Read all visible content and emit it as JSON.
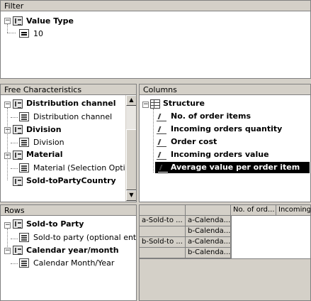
{
  "filter": {
    "title": "Filter",
    "items": [
      {
        "label": "Value Type",
        "value": "10"
      }
    ]
  },
  "free_characteristics": {
    "title": "Free Characteristics",
    "items": [
      {
        "label": "Distribution channel",
        "sub": "Distribution channel"
      },
      {
        "label": "Division",
        "sub": "Division"
      },
      {
        "label": "Material",
        "sub": "Material (Selection Options"
      },
      {
        "label": "Sold-toPartyCountry"
      }
    ]
  },
  "columns": {
    "title": "Columns",
    "root": "Structure",
    "items": [
      {
        "label": "No. of order items"
      },
      {
        "label": "Incoming orders quantity"
      },
      {
        "label": "Order cost"
      },
      {
        "label": "Incoming orders value"
      },
      {
        "label": "Average value per order item",
        "selected": true
      }
    ]
  },
  "rows": {
    "title": "Rows",
    "items": [
      {
        "label": "Sold-to Party",
        "sub": "Sold-to party (optional entry)"
      },
      {
        "label": "Calendar year/month",
        "sub": "Calendar Month/Year"
      }
    ]
  },
  "grid": {
    "headers": [
      "No. of ord...",
      "Incoming"
    ],
    "row_a": [
      "a-Sold-to ...",
      "a-Calenda..."
    ],
    "row_b": [
      "",
      "b-Calenda..."
    ],
    "row_c": [
      "b-Sold-to ...",
      "a-Calenda..."
    ],
    "row_d": [
      "",
      "b-Calenda..."
    ]
  }
}
